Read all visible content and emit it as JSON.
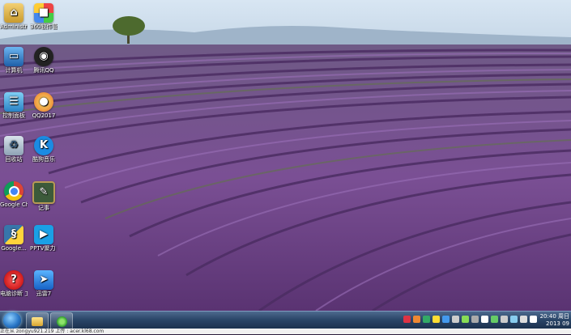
{
  "desktop_icons": [
    {
      "label": "Administrator",
      "icon": "folder-user-icon"
    },
    {
      "label": "360软件管家",
      "icon": "app-manager-icon"
    },
    {
      "label": "计算机",
      "icon": "computer-icon"
    },
    {
      "label": "腾讯QQ",
      "icon": "qq-icon"
    },
    {
      "label": "控制面板",
      "icon": "control-panel-icon"
    },
    {
      "label": "QQ2017",
      "icon": "qq-browser-icon"
    },
    {
      "label": "回收站",
      "icon": "recycle-bin-icon"
    },
    {
      "label": "酷狗音乐",
      "icon": "kugou-icon"
    },
    {
      "label": "Google Chrome",
      "icon": "chrome-icon"
    },
    {
      "label": "记事",
      "icon": "notepad-icon"
    },
    {
      "label": "Google...",
      "icon": "python-icon"
    },
    {
      "label": "PPTV聚力 网络电视",
      "icon": "pptv-icon"
    },
    {
      "label": "电脑诊断 工具",
      "icon": "help-icon"
    },
    {
      "label": "迅雷7",
      "icon": "thunder-icon"
    }
  ],
  "taskbar": {
    "buttons": [
      {
        "icon": "windows-explorer-icon"
      },
      {
        "icon": "chrome-icon"
      }
    ],
    "tray_colors": [
      "#d34",
      "#e83",
      "#3a6",
      "#fd3",
      "#49e",
      "#ccc",
      "#8d5",
      "#aaa",
      "#fff",
      "#6c6",
      "#ccc",
      "#8ce",
      "#ddd",
      "#fff"
    ]
  },
  "clock": {
    "time": "20:40 周日",
    "date": "2013 09 29"
  },
  "status": {
    "text": "正在从 zongyu921.219 上传 : acer.kl68.com"
  }
}
